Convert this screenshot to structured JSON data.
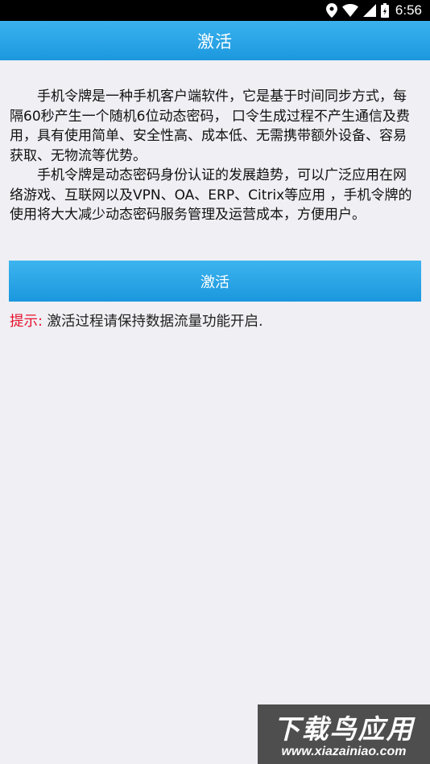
{
  "status_bar": {
    "time": "6:56",
    "icons": [
      "location-icon",
      "wifi-icon",
      "signal-icon",
      "battery-icon"
    ]
  },
  "app_bar": {
    "title": "激活"
  },
  "description": {
    "paragraph_1": "手机令牌是一种手机客户端软件，它是基于时间同步方式，每隔60秒产生一个随机6位动态密码， 口令生成过程不产生通信及费用，具有使用简单、安全性高、成本低、无需携带额外设备、容易获取、无物流等优势。",
    "paragraph_2": "手机令牌是动态密码身份认证的发展趋势，可以广泛应用在网络游戏、互联网以及VPN、OA、ERP、Citrix等应用 ，手机令牌的使用将大大减少动态密码服务管理及运营成本，方便用户。"
  },
  "activate_button": {
    "label": "激活"
  },
  "hint": {
    "label": "提示:",
    "text": "激活过程请保持数据流量功能开启."
  },
  "watermark": {
    "title": "下载鸟应用",
    "url": "www.xiazainiao.com"
  },
  "colors": {
    "accent": "#1e9ae0",
    "hint_label": "#e8102a",
    "background": "#efeff4"
  }
}
